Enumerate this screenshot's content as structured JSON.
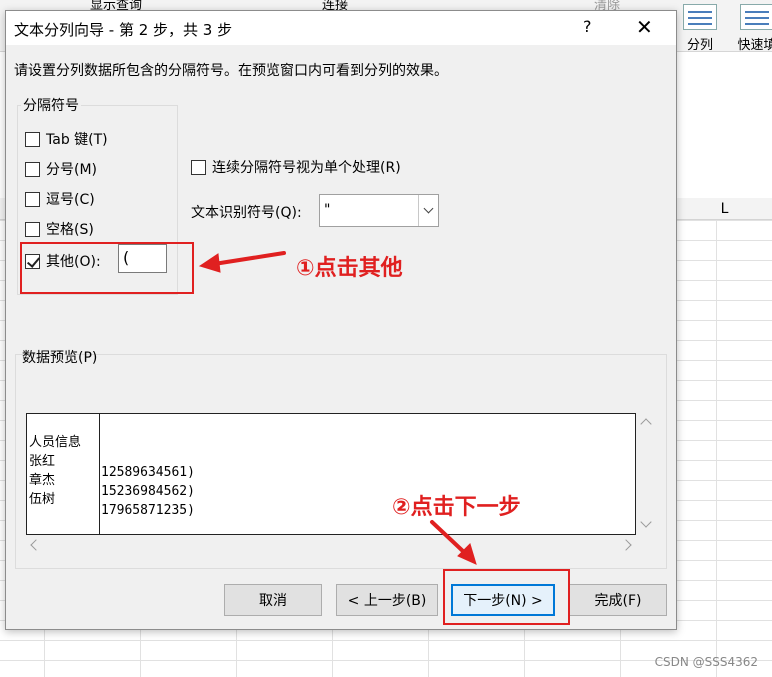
{
  "ribbon": {
    "partial_left_1": "显示查询",
    "partial_left_2": "连接",
    "partial_clear": "清除",
    "split_label": "分列",
    "flash_fill_label": "快速填"
  },
  "grid": {
    "col_L": "L"
  },
  "watermark": "CSDN @SSS4362",
  "dialog": {
    "title": "文本分列向导 - 第 2 步，共 3 步",
    "help": "?",
    "close": "✕",
    "instruction": "请设置分列数据所包含的分隔符号。在预览窗口内可看到分列的效果。",
    "delimiters_legend": "分隔符号",
    "delimiters": [
      {
        "label": "Tab 键(T)",
        "checked": false
      },
      {
        "label": "分号(M)",
        "checked": false
      },
      {
        "label": "逗号(C)",
        "checked": false
      },
      {
        "label": "空格(S)",
        "checked": false
      },
      {
        "label": "其他(O):",
        "checked": true
      }
    ],
    "other_value": "(",
    "consecutive_label": "连续分隔符号视为单个处理(R)",
    "text_qualifier_label": "文本识别符号(Q):",
    "text_qualifier_value": "\"",
    "preview_legend": "数据预览(P)",
    "preview_rows": [
      {
        "c1": "人员信息",
        "c2": ""
      },
      {
        "c1": "张红",
        "c2": "12589634561)"
      },
      {
        "c1": "章杰",
        "c2": "15236984562)"
      },
      {
        "c1": "伍树",
        "c2": "17965871235)"
      }
    ],
    "buttons": {
      "cancel": "取消",
      "back": "< 上一步(B)",
      "next": "下一步(N) >",
      "finish": "完成(F)"
    }
  },
  "annotations": {
    "step1": "①点击其他",
    "step2": "②点击下一步",
    "color": "#e02020"
  }
}
